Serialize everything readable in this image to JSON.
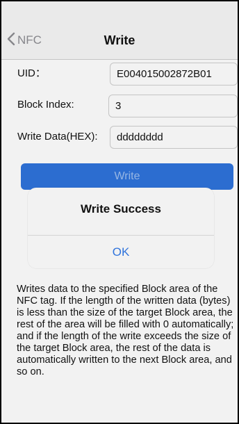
{
  "navbar": {
    "back_label": "NFC",
    "title": "Write"
  },
  "form": {
    "uid_label": "UID：",
    "uid_value": "E004015002872B01",
    "block_index_label": "Block Index:",
    "block_index_value": "3",
    "write_data_label": "Write Data(HEX):",
    "write_data_value": "dddddddd"
  },
  "actions": {
    "write_label": "Write"
  },
  "alert": {
    "title": "Write Success",
    "ok_label": "OK"
  },
  "description": "Writes data to the specified Block area of the NFC tag. If the length of the written data (bytes) is less than the size of the target Block area, the rest of the area will be filled with 0 automatically; and if the length of the write exceeds the size of the target Block area, the rest of the data is automatically written to the next Block area, and so on.",
  "colors": {
    "accent": "#2f73dc",
    "nav_background": "#f7f7f7",
    "back_text": "#8e8e93"
  },
  "icons": {
    "back": "chevron-left-icon"
  }
}
